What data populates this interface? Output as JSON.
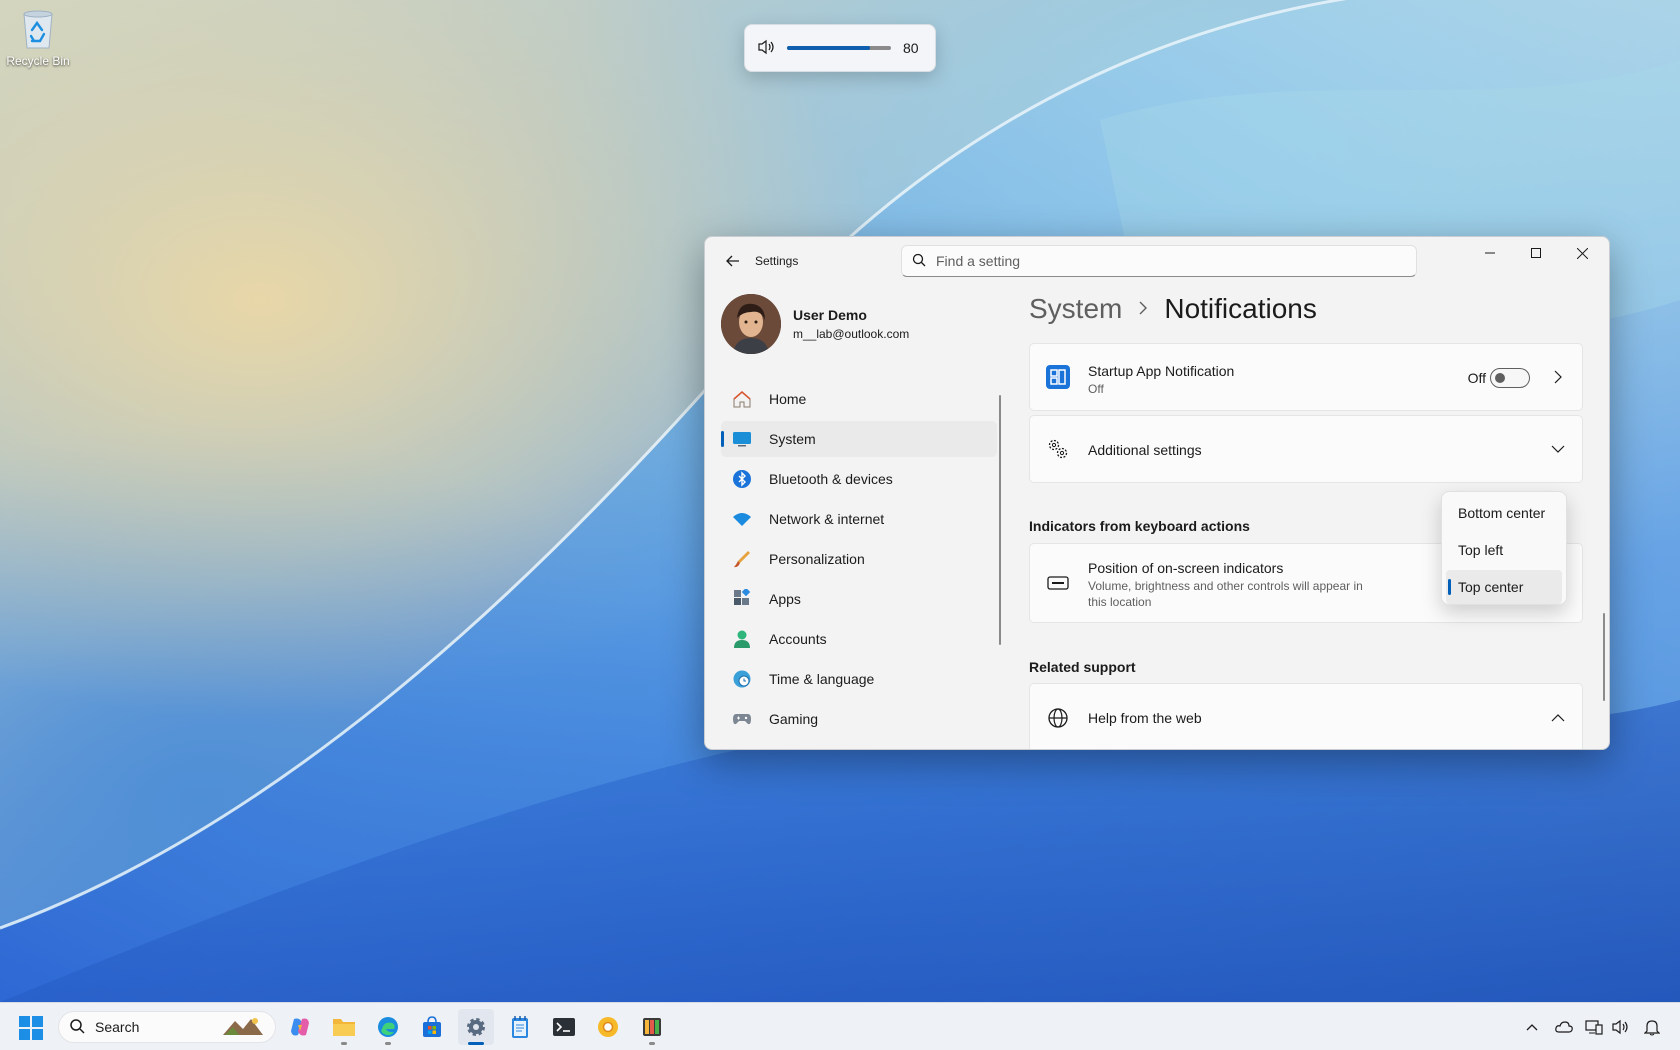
{
  "desktop": {
    "recycle_bin_label": "Recycle Bin"
  },
  "volume_flyout": {
    "value": 80,
    "level_fraction": 0.8,
    "value_label": "80",
    "icon": "speaker-icon"
  },
  "window": {
    "app_title": "Settings",
    "search_placeholder": "Find a setting",
    "controls": [
      "minimize",
      "maximize",
      "close"
    ]
  },
  "profile": {
    "name": "User Demo",
    "email": "m__lab@outlook.com"
  },
  "nav": {
    "items": [
      {
        "label": "Home",
        "icon": "home-icon"
      },
      {
        "label": "System",
        "icon": "system-icon",
        "selected": true
      },
      {
        "label": "Bluetooth & devices",
        "icon": "bluetooth-icon"
      },
      {
        "label": "Network & internet",
        "icon": "wifi-icon"
      },
      {
        "label": "Personalization",
        "icon": "brush-icon"
      },
      {
        "label": "Apps",
        "icon": "apps-icon"
      },
      {
        "label": "Accounts",
        "icon": "account-icon"
      },
      {
        "label": "Time & language",
        "icon": "clock-globe-icon"
      },
      {
        "label": "Gaming",
        "icon": "controller-icon"
      }
    ]
  },
  "breadcrumb": {
    "parent": "System",
    "current": "Notifications"
  },
  "startup_card": {
    "title": "Startup App Notification",
    "subtitle": "Off",
    "toggle_label": "Off",
    "toggle_on": false
  },
  "additional_settings": {
    "title": "Additional settings"
  },
  "indicators_section": {
    "heading": "Indicators from keyboard actions"
  },
  "position_card": {
    "title": "Position of on-screen indicators",
    "description": "Volume, brightness and other controls will appear in this location"
  },
  "position_dropdown": {
    "options": [
      "Bottom center",
      "Top left",
      "Top center"
    ],
    "selected": "Top center"
  },
  "related_support": {
    "heading": "Related support",
    "help_title": "Help from the web"
  },
  "taskbar": {
    "search_label": "Search",
    "apps": [
      "copilot",
      "file-explorer",
      "edge",
      "store",
      "settings",
      "notepad",
      "terminal",
      "canary",
      "app"
    ],
    "active_app": "settings"
  },
  "colors": {
    "accent": "#005fb8"
  }
}
